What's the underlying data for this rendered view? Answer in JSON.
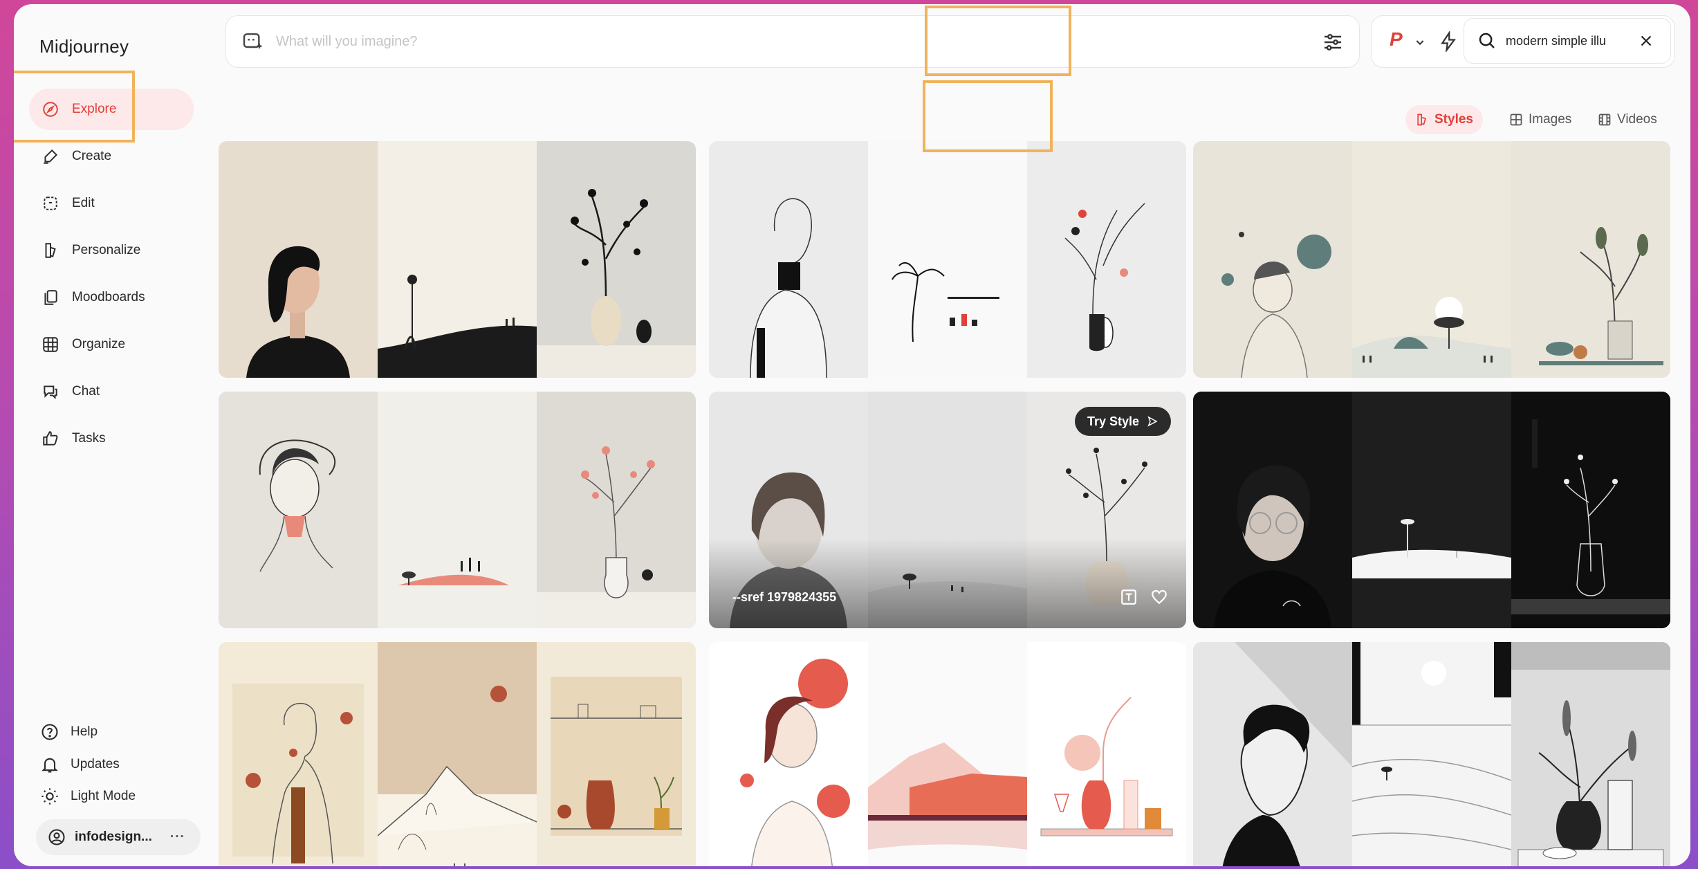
{
  "app": {
    "brand": "Midjourney"
  },
  "sidebar": {
    "items": [
      {
        "label": "Explore",
        "icon": "compass-icon",
        "active": true
      },
      {
        "label": "Create",
        "icon": "brush-icon"
      },
      {
        "label": "Edit",
        "icon": "edit-icon"
      },
      {
        "label": "Personalize",
        "icon": "personalize-icon"
      },
      {
        "label": "Moodboards",
        "icon": "moodboard-icon"
      },
      {
        "label": "Organize",
        "icon": "grid-icon"
      },
      {
        "label": "Chat",
        "icon": "chat-icon"
      },
      {
        "label": "Tasks",
        "icon": "thumbs-up-icon"
      }
    ],
    "bottom": [
      {
        "label": "Help",
        "icon": "help-icon"
      },
      {
        "label": "Updates",
        "icon": "bell-icon"
      },
      {
        "label": "Light Mode",
        "icon": "sun-icon"
      }
    ],
    "account": {
      "name": "infodesign...",
      "more": "···"
    }
  },
  "prompt": {
    "placeholder": "What will you imagine?"
  },
  "model": {
    "letter": "P"
  },
  "search": {
    "value": "modern simple illu"
  },
  "tabs": [
    {
      "label": "Styles",
      "active": true
    },
    {
      "label": "Images"
    },
    {
      "label": "Videos"
    }
  ],
  "hover_card": {
    "try_label": "Try Style",
    "sref": "--sref 1979824355"
  },
  "colors": {
    "accent": "#e0413a",
    "accent_bg": "#fde8ea",
    "highlight": "#f0b35c"
  }
}
